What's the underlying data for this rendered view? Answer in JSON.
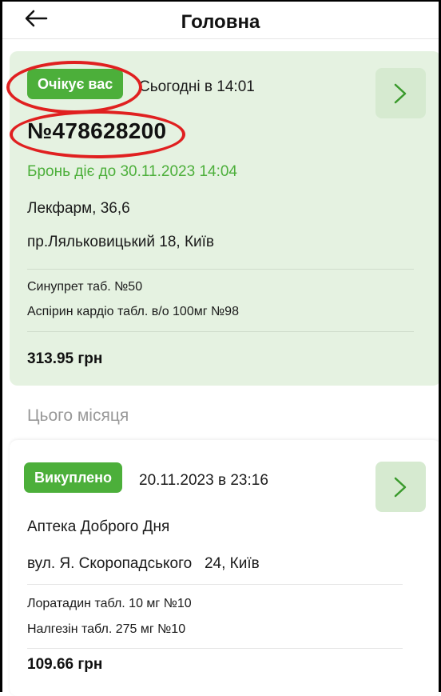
{
  "header": {
    "title": "Головна"
  },
  "active_order": {
    "status": "Очікує вас",
    "datetime": "Сьогодні в 14:01",
    "number": "№478628200",
    "reserve_until": "Бронь діє до 30.11.2023 14:04",
    "pharmacy": "Лекфарм, 36,6",
    "address": "пр.Ляльковицький 18, Київ",
    "items": [
      "Синупрет таб. №50",
      "Аспірин кардіо табл. в/о 100мг №98"
    ],
    "total": "313.95 грн"
  },
  "section_title": "Цього місяця",
  "past_order": {
    "status": "Викуплено",
    "datetime": "20.11.2023 в 23:16",
    "pharmacy": "Аптека Доброго Дня",
    "address": "вул. Я. Скоропадського   24, Київ",
    "items": [
      "Лоратадин табл. 10 мг №10",
      "Налгезін табл. 275 мг №10"
    ],
    "total": "109.66 грн"
  },
  "colors": {
    "accent_green": "#4caf3a",
    "card_bg": "#e5f2e1",
    "annotation_red": "#e02020"
  },
  "icons": {
    "back": "arrow-left-icon",
    "open": "chevron-right-icon"
  }
}
